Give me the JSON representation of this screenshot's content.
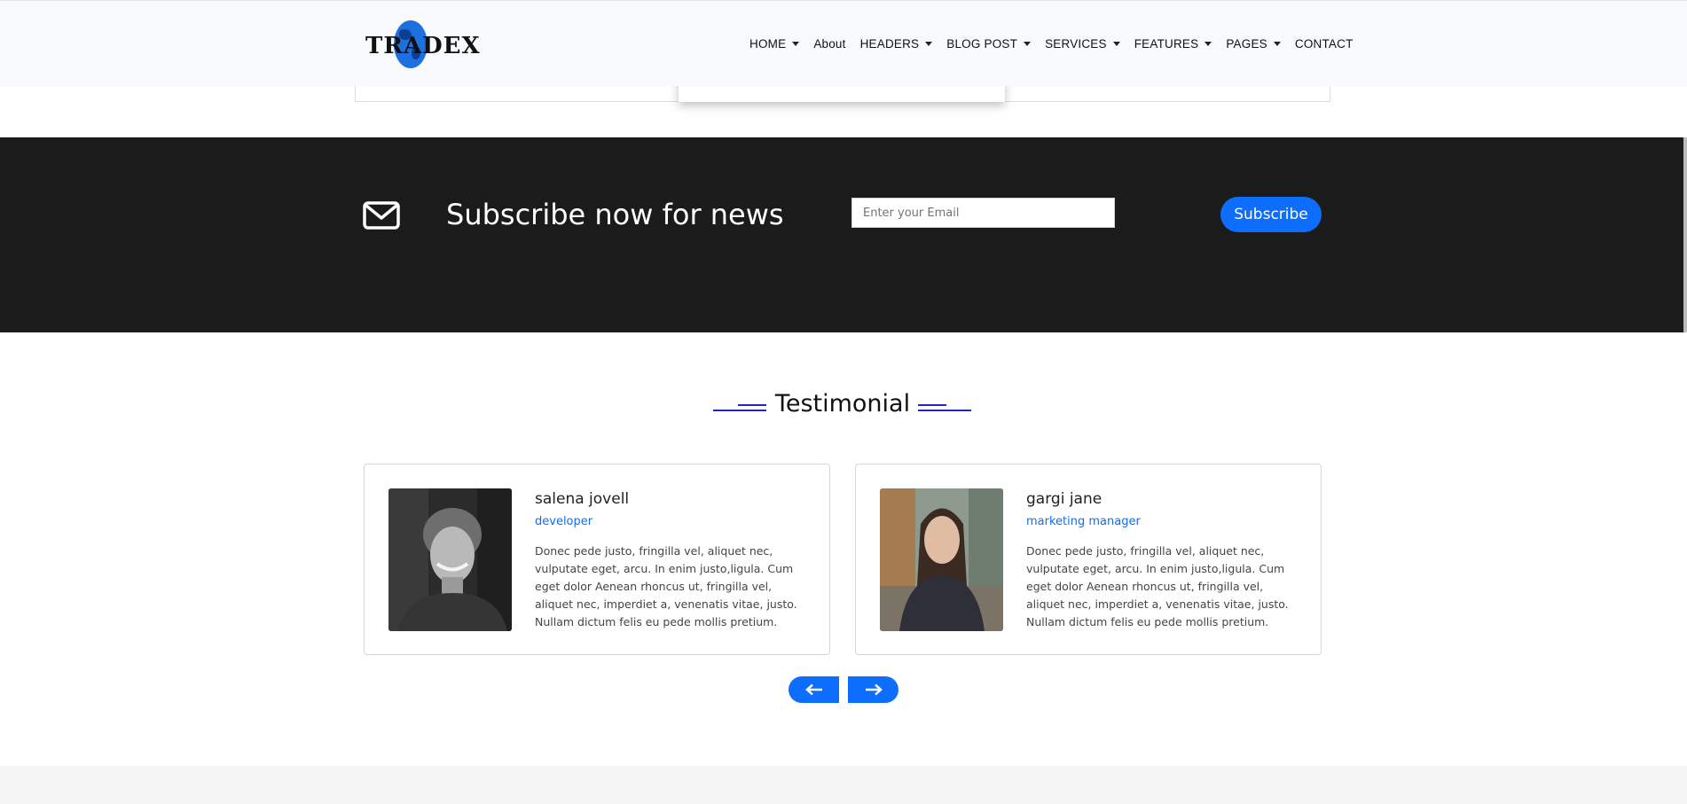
{
  "navbar": {
    "logo_text": "TRADEX",
    "items": [
      {
        "label": "HOME",
        "dropdown": true
      },
      {
        "label": "About",
        "dropdown": false
      },
      {
        "label": "HEADERS",
        "dropdown": true
      },
      {
        "label": "BLOG POST",
        "dropdown": true
      },
      {
        "label": "SERVICES",
        "dropdown": true
      },
      {
        "label": "FEATURES",
        "dropdown": true
      },
      {
        "label": "PAGES",
        "dropdown": true
      },
      {
        "label": "CONTACT",
        "dropdown": false
      }
    ]
  },
  "subscribe": {
    "icon": "envelope-icon",
    "title": "Subscribe now for news",
    "email_placeholder": "Enter your Email",
    "email_value": "",
    "button_label": "Subscribe"
  },
  "testimonial": {
    "heading": "Testimonial",
    "cards": [
      {
        "name": "salena jovell",
        "role": "developer",
        "text": "Donec pede justo, fringilla vel, aliquet nec, vulputate eget, arcu. In enim justo,ligula. Cum eget dolor Aenean rhoncus ut, fringilla vel, aliquet nec, imperdiet a, venenatis vitae, justo. Nullam dictum felis eu pede mollis pretium."
      },
      {
        "name": "gargi jane",
        "role": "marketing manager",
        "text": "Donec pede justo, fringilla vel, aliquet nec, vulputate eget, arcu. In enim justo,ligula. Cum eget dolor Aenean rhoncus ut, fringilla vel, aliquet nec, imperdiet a, venenatis vitae, justo. Nullam dictum felis eu pede mollis pretium."
      }
    ],
    "prev_icon": "arrow-left-icon",
    "next_icon": "arrow-right-icon"
  },
  "colors": {
    "accent": "#0d6efd",
    "dark_band": "#1b1b1b",
    "navbar_bg": "#f8f9fa",
    "heading_deco": "#2323c7"
  }
}
